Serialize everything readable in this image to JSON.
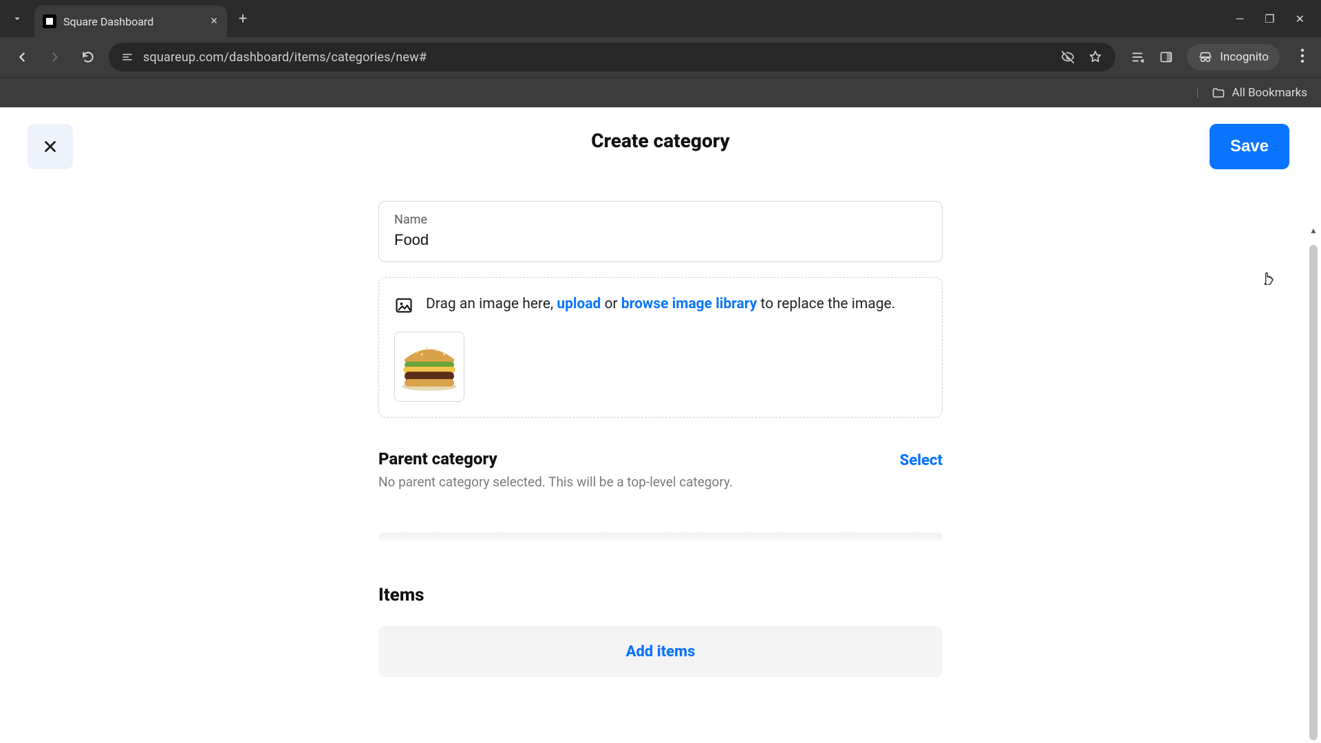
{
  "browser": {
    "tab_title": "Square Dashboard",
    "url": "squareup.com/dashboard/items/categories/new#",
    "incognito_label": "Incognito",
    "all_bookmarks": "All Bookmarks"
  },
  "header": {
    "title": "Create category",
    "save_label": "Save"
  },
  "form": {
    "name_label": "Name",
    "name_value": "Food"
  },
  "dropzone": {
    "prefix": "Drag an image here, ",
    "upload_label": "upload",
    "middle1": " or ",
    "browse_label": "browse image library",
    "suffix": " to replace the image."
  },
  "parent": {
    "title": "Parent category",
    "subtitle": "No parent category selected. This will be a top-level category.",
    "select_label": "Select"
  },
  "items": {
    "title": "Items",
    "add_label": "Add items"
  }
}
